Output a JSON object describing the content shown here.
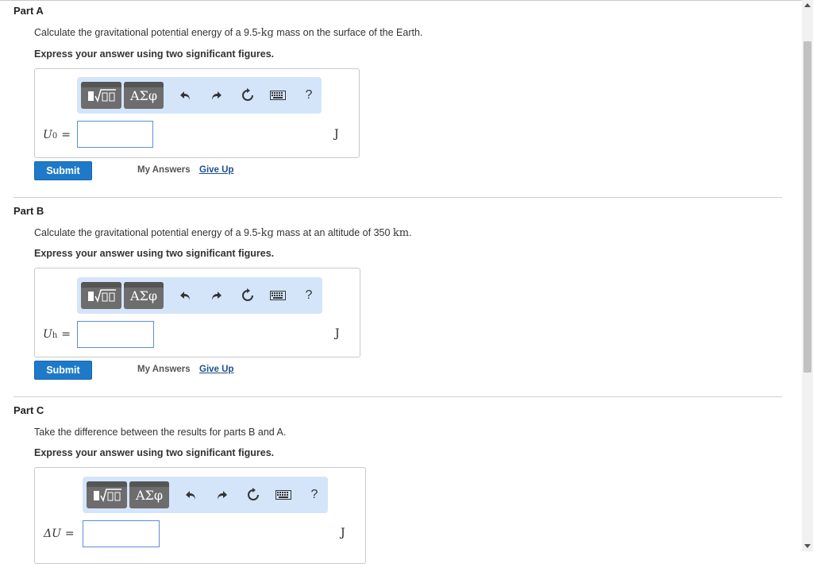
{
  "colors": {
    "accent": "#1e7ac9",
    "toolbar_bg": "#d4e5fa",
    "link": "#1d4f8f",
    "input_border": "#5b8fd0"
  },
  "toolbar": {
    "templates_icon": "templates-sqrt-icon",
    "greek_label": "ΑΣφ",
    "undo_icon": "undo-icon",
    "redo_icon": "redo-icon",
    "reset_icon": "reset-icon",
    "keyboard_icon": "keyboard-icon",
    "help_label": "?"
  },
  "parts": [
    {
      "title": "Part A",
      "question_pre": "Calculate the gravitational potential energy of a 9.5-",
      "question_unit": "kg",
      "question_post": " mass on the surface of the Earth.",
      "instruction": "Express your answer using two significant figures.",
      "var_main": "U",
      "var_sub": "0",
      "var_eq": "=",
      "value": "",
      "unit": "J",
      "submit_label": "Submit",
      "my_answers_label": "My Answers",
      "give_up_label": "Give Up"
    },
    {
      "title": "Part B",
      "question_pre": "Calculate the gravitational potential energy of a 9.5-",
      "question_unit": "kg",
      "question_post": " mass at an altitude of 350 ",
      "question_unit2": "km",
      "question_end": ".",
      "instruction": "Express your answer using two significant figures.",
      "var_main": "U",
      "var_sub": "h",
      "var_eq": "=",
      "value": "",
      "unit": "J",
      "submit_label": "Submit",
      "my_answers_label": "My Answers",
      "give_up_label": "Give Up"
    },
    {
      "title": "Part C",
      "question_pre": "Take the difference between the results for parts B and A.",
      "instruction": "Express your answer using two significant figures.",
      "var_main": "ΔU",
      "var_eq": "=",
      "value": "",
      "unit": "J"
    }
  ]
}
